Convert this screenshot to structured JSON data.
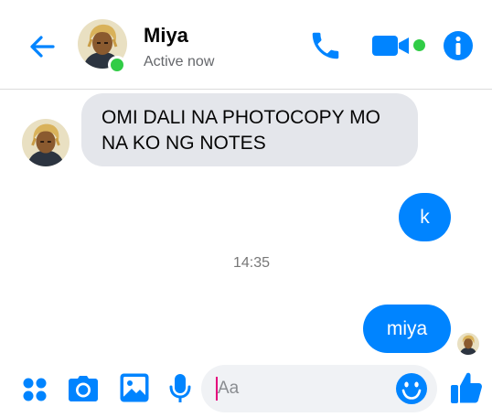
{
  "header": {
    "contact_name": "Miya",
    "status": "Active now",
    "accent_color": "#0084ff",
    "online_color": "#31cc46",
    "icons": [
      "back-arrow-icon",
      "phone-icon",
      "video-camera-icon",
      "info-icon"
    ]
  },
  "messages": [
    {
      "direction": "incoming",
      "text": "OMI DALI NA PHOTOCOPY MO NA KO NG NOTES"
    },
    {
      "direction": "outgoing",
      "text": "k"
    },
    {
      "type": "timestamp",
      "text": "14:35"
    },
    {
      "direction": "outgoing",
      "text": "miya"
    }
  ],
  "composer": {
    "placeholder": "Aa",
    "icons": [
      "apps-grid-icon",
      "camera-icon",
      "gallery-icon",
      "microphone-icon",
      "emoji-icon",
      "thumbs-up-icon"
    ]
  }
}
